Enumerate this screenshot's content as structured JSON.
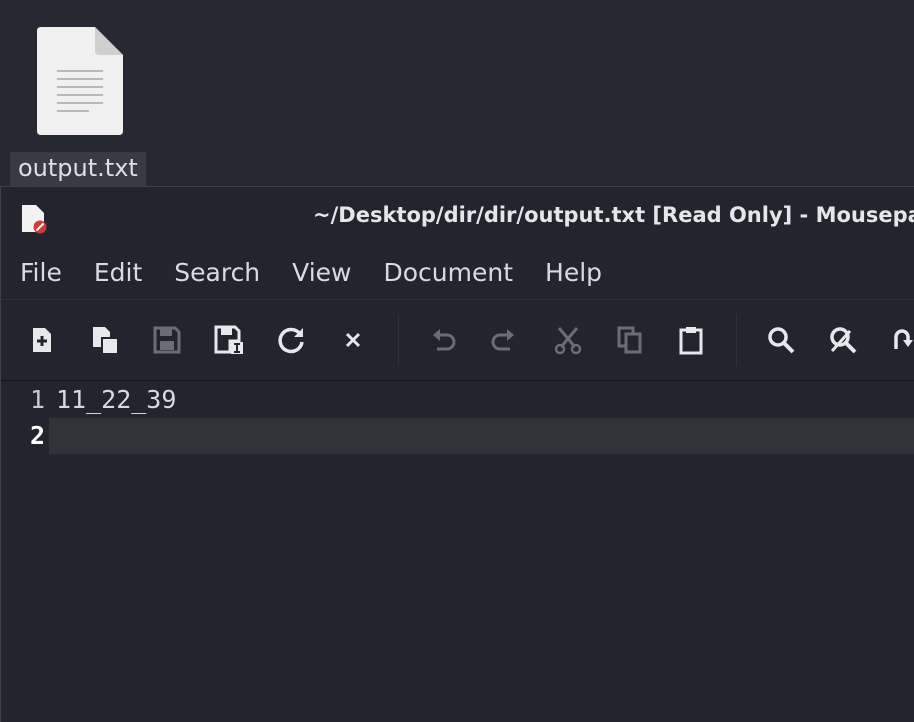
{
  "desktop": {
    "file_icon": "text-file-icon",
    "file_label": "output.txt"
  },
  "window": {
    "app_icon": "mousepad-readonly-icon",
    "title": "~/Desktop/dir/dir/output.txt [Read Only] - Mousepad"
  },
  "menubar": {
    "items": [
      "File",
      "Edit",
      "Search",
      "View",
      "Document",
      "Help"
    ]
  },
  "toolbar": {
    "buttons": [
      {
        "icon": "new-document-icon",
        "enabled": true
      },
      {
        "icon": "new-window-icon",
        "enabled": true
      },
      {
        "icon": "save-icon",
        "enabled": false
      },
      {
        "icon": "save-as-icon",
        "enabled": true
      },
      {
        "icon": "reload-icon",
        "enabled": true
      },
      {
        "icon": "close-icon",
        "enabled": true
      },
      {
        "icon": "undo-icon",
        "enabled": false
      },
      {
        "icon": "redo-icon",
        "enabled": false
      },
      {
        "icon": "cut-icon",
        "enabled": false
      },
      {
        "icon": "copy-icon",
        "enabled": false
      },
      {
        "icon": "paste-icon",
        "enabled": true
      },
      {
        "icon": "find-icon",
        "enabled": true
      },
      {
        "icon": "find-replace-icon",
        "enabled": true
      },
      {
        "icon": "go-to-line-icon",
        "enabled": true
      }
    ]
  },
  "editor": {
    "lines": [
      {
        "number": "1",
        "text": "11_22_39"
      },
      {
        "number": "2",
        "text": ""
      }
    ],
    "current_line": 2
  },
  "colors": {
    "background": "#262932",
    "window": "#22252d",
    "current_line": "#313338",
    "icon_enabled": "#e6e8ec",
    "icon_disabled": "#6a6d75"
  }
}
